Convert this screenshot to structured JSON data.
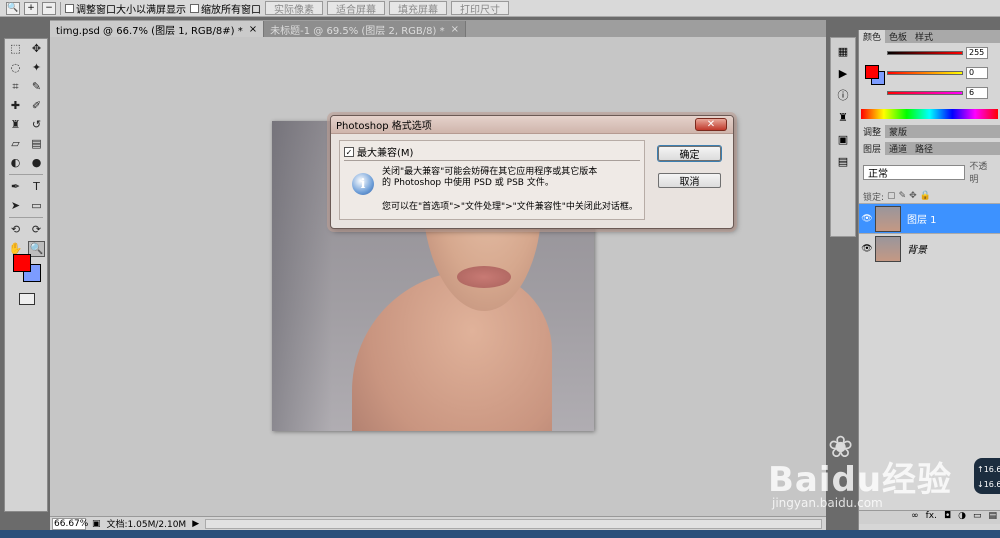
{
  "options_bar": {
    "checkbox_resize": "调整窗口大小以满屏显示",
    "checkbox_zoom_all": "缩放所有窗口",
    "btn_actual_pixels": "实际像素",
    "btn_fit_screen": "适合屏幕",
    "btn_fill_screen": "填充屏幕",
    "btn_print_size": "打印尺寸"
  },
  "tabs": [
    {
      "label": "timg.psd @ 66.7% (图层 1, RGB/8#) *",
      "close": "×"
    },
    {
      "label": "未标题-1 @ 69.5% (图层 2, RGB/8) *",
      "close": "×"
    }
  ],
  "dialog": {
    "title": "Photoshop 格式选项",
    "close": "✕",
    "checkbox_label": "最大兼容(M)",
    "checkbox_mark": "✓",
    "info_glyph": "i",
    "message_line1": "关闭\"最大兼容\"可能会妨碍在其它应用程序或其它版本",
    "message_line2": "的 Photoshop 中使用 PSD 或 PSB 文件。",
    "message_line3": "您可以在\"首选项\">\"文件处理\">\"文件兼容性\"中关闭此对话框。",
    "ok_label": "确定",
    "cancel_label": "取消"
  },
  "status_bar": {
    "zoom": "66.67%",
    "doc_info": "文档:1.05M/2.10M"
  },
  "right_panel": {
    "top_tabs": [
      "颜色",
      "色板",
      "样式"
    ],
    "color_values": [
      "255",
      "0",
      "6"
    ],
    "adjust_tabs": [
      "调整",
      "蒙版"
    ],
    "layer_tabs": [
      "图层",
      "通道",
      "路径"
    ],
    "blend_mode": "正常",
    "opacity_label": "不透明",
    "lock_label": "锁定:",
    "layers": [
      {
        "name": "图层 1",
        "selected": true
      },
      {
        "name": "背景",
        "selected": false
      }
    ],
    "footer_icons": [
      "∞",
      "fx.",
      "◘",
      "◑",
      "▭",
      "▤"
    ]
  },
  "watermark": {
    "paw": "❀",
    "brand": "Baidu经验",
    "url": "jingyan.baidu.com"
  },
  "net_overlay": {
    "up": "16.6",
    "down": "16.6"
  },
  "colors": {
    "foreground": "#ff0000",
    "background": "#7c9cff",
    "selected_layer": "#3d92ff"
  }
}
